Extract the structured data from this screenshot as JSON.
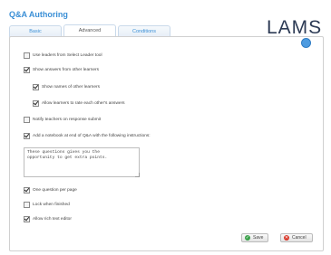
{
  "app": {
    "title": "Q&A Authoring",
    "logo": "LAMS"
  },
  "tabs": [
    {
      "label": "Basic",
      "active": false
    },
    {
      "label": "Advanced",
      "active": true
    },
    {
      "label": "Conditions",
      "active": false
    }
  ],
  "options": {
    "use_leaders": {
      "label": "Use leaders from Select Leader tool",
      "checked": false
    },
    "show_answers": {
      "label": "Show answers from other learners",
      "checked": true
    },
    "show_names": {
      "label": "Show names of other learners",
      "checked": true
    },
    "allow_rate": {
      "label": "Allow learners to rate each other's answers",
      "checked": true
    },
    "notify_teachers": {
      "label": "Notify teachers on response submit",
      "checked": false
    },
    "add_notebook": {
      "label": "Add a notebook at end of Q&A with the following instructions:",
      "checked": true
    },
    "one_question": {
      "label": "One question per page",
      "checked": true
    },
    "lock_finished": {
      "label": "Lock when finished",
      "checked": false
    },
    "rich_text": {
      "label": "Allow rich text editor",
      "checked": true
    }
  },
  "notebook_instructions": "These questions gives you the\nopportunity to get extra points.",
  "buttons": {
    "save": "Save",
    "cancel": "Cancel"
  },
  "colors": {
    "accent": "#3a8fd6",
    "save_icon": "#3aa14a",
    "cancel_icon": "#d93a2c"
  }
}
